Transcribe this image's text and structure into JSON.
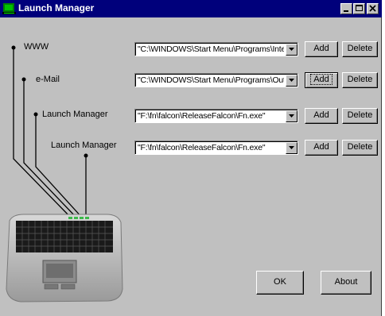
{
  "window": {
    "title": "Launch Manager"
  },
  "titlebar_buttons": [
    "minimize",
    "maximize",
    "close"
  ],
  "rows": [
    {
      "label": "WWW",
      "path": "\"C:\\WINDOWS\\Start Menu\\Programs\\Intern",
      "add": "Add",
      "delete": "Delete"
    },
    {
      "label": "e-Mail",
      "path": "\"C:\\WINDOWS\\Start Menu\\Programs\\Outlo",
      "add": "Add",
      "delete": "Delete"
    },
    {
      "label": "Launch Manager",
      "path": "\"F:\\fn\\falcon\\ReleaseFalcon\\Fn.exe\"",
      "add": "Add",
      "delete": "Delete"
    },
    {
      "label": "Launch Manager",
      "path": "\"F:\\fn\\falcon\\ReleaseFalcon\\Fn.exe\"",
      "add": "Add",
      "delete": "Delete"
    }
  ],
  "footer": {
    "ok": "OK",
    "about": "About"
  },
  "colors": {
    "titlebar": "#00007b",
    "face": "#c0c0c0",
    "laptop_body": "#b8b8b8"
  }
}
